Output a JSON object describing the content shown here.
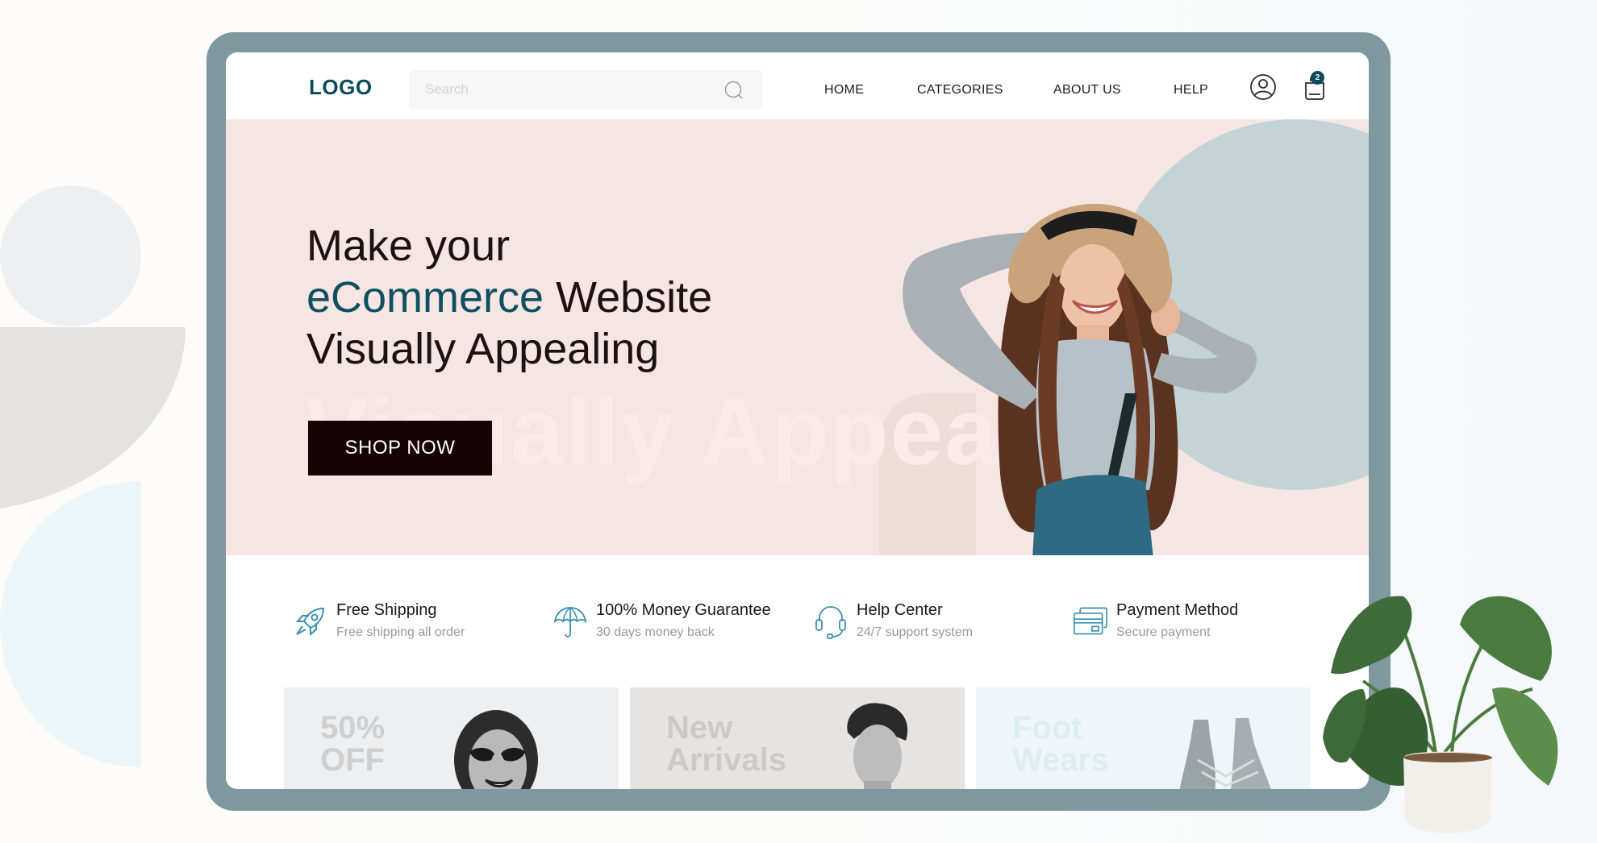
{
  "colors": {
    "brand": "#0e4a5c",
    "accent": "#0e4f60",
    "frame": "#7e989e",
    "hero_bg": "#f5e6e4",
    "hero_blob": "#c3d3d6",
    "button_bg": "#150305",
    "icon_stroke": "#3a8fb0"
  },
  "nav": {
    "logo": "LOGO",
    "search_placeholder": "Search",
    "links": [
      "HOME",
      "CATEGORIES",
      "ABOUT US",
      "HELP"
    ],
    "account_icon": "user-circle-icon",
    "cart_icon": "shopping-bag-icon",
    "cart_count": "2"
  },
  "hero": {
    "title_line1": "Make your",
    "title_accent": "eCommerce",
    "title_line2_rest": " Website",
    "title_line3": "Visually Appealing",
    "ghost_text": "Visually Appealing",
    "cta_label": "SHOP NOW"
  },
  "features": [
    {
      "icon": "rocket-icon",
      "title": "Free Shipping",
      "subtitle": "Free shipping all order"
    },
    {
      "icon": "umbrella-icon",
      "title": "100% Money Guarantee",
      "subtitle": "30 days money back"
    },
    {
      "icon": "headset-icon",
      "title": "Help Center",
      "subtitle": "24/7 support system"
    },
    {
      "icon": "credit-card-icon",
      "title": "Payment Method",
      "subtitle": "Secure payment"
    }
  ],
  "promos": [
    {
      "line1": "50%",
      "line2": "OFF",
      "bg": "#eeeff1",
      "text_color": "#cfcfcf"
    },
    {
      "line1": "New",
      "line2": "Arrivals",
      "bg": "#e5e4e0",
      "text_color": "#cbcac6"
    },
    {
      "line1": "Foot",
      "line2": "Wears",
      "bg": "#eef6f9",
      "text_color": "#dcedf3"
    }
  ]
}
